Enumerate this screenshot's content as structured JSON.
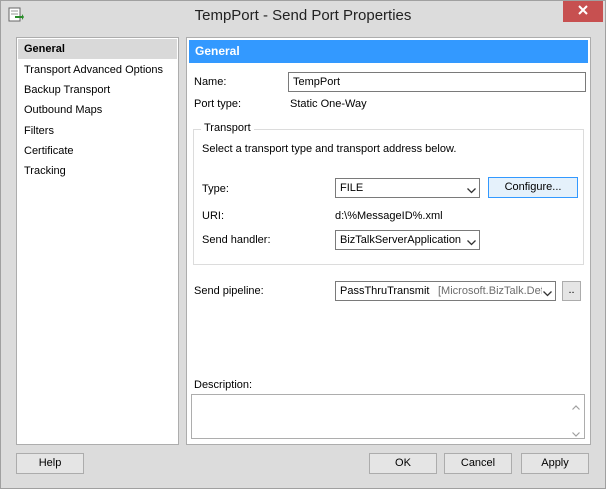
{
  "window": {
    "title": "TempPort - Send Port Properties"
  },
  "nav": {
    "items": [
      {
        "label": "General",
        "selected": true
      },
      {
        "label": "Transport Advanced Options",
        "selected": false
      },
      {
        "label": "Backup Transport",
        "selected": false
      },
      {
        "label": "Outbound Maps",
        "selected": false
      },
      {
        "label": "Filters",
        "selected": false
      },
      {
        "label": "Certificate",
        "selected": false
      },
      {
        "label": "Tracking",
        "selected": false
      }
    ]
  },
  "panel": {
    "header": "General",
    "name": {
      "label": "Name:",
      "value": "TempPort"
    },
    "port_type": {
      "label": "Port type:",
      "value": "Static One-Way"
    },
    "transport": {
      "group_label": "Transport",
      "instruction": "Select a transport type and transport address below.",
      "type_label": "Type:",
      "type_value": "FILE",
      "configure_label": "Configure...",
      "uri_label": "URI:",
      "uri_value": "d:\\%MessageID%.xml",
      "send_handler_label": "Send handler:",
      "send_handler_value": "BizTalkServerApplication"
    },
    "send_pipeline": {
      "label": "Send pipeline:",
      "name": "PassThruTransmit",
      "type": "[Microsoft.BizTalk.Defa",
      "browse_label": ".."
    },
    "description": {
      "label": "Description:",
      "value": ""
    }
  },
  "buttons": {
    "help": "Help",
    "ok": "OK",
    "cancel": "Cancel",
    "apply": "Apply"
  },
  "colors": {
    "accent": "#3399ff",
    "close": "#c75050"
  }
}
